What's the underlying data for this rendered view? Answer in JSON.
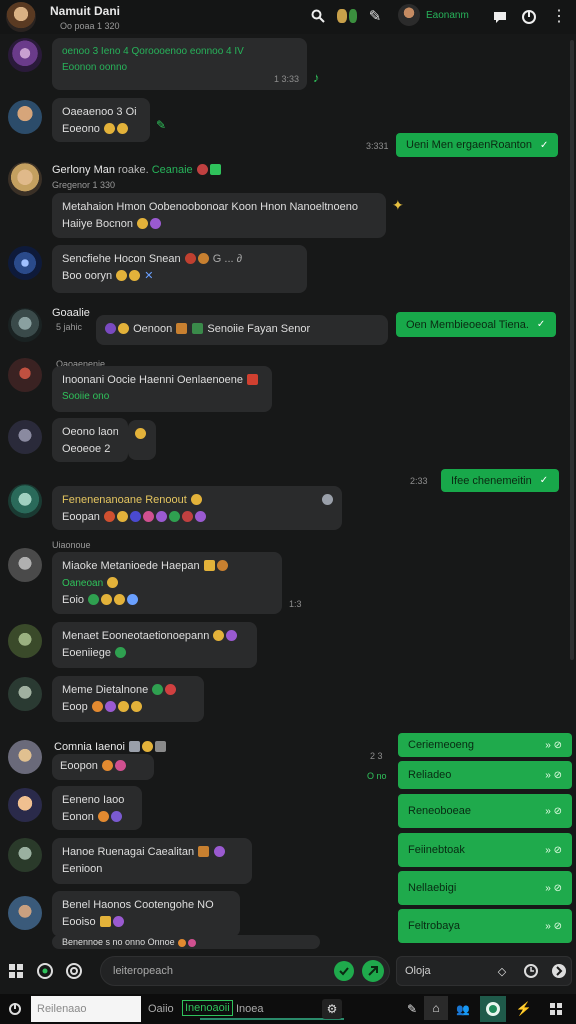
{
  "header": {
    "title": "Namuit Dani",
    "subtitle": "Oo poaa 1 320",
    "contact_name": "Eaonanm"
  },
  "messages_in": [
    {
      "line1": "oenoo 3 Ieno 4 Qoroooenoo eonnoo 4 IV",
      "line2": "Eoonon oonno",
      "time": "1 3:33"
    },
    {
      "line1": "Oaeaenoo 3 Oi 3",
      "line2": "Eoeono"
    },
    {
      "name": "Gerlony Man",
      "name_tag": "roake.",
      "name_tag2": "Ceanaie",
      "sub": "Gregenor 1 330",
      "line1": "Metahaion Hmon Oobenoobonoar Koon Hnon Nanoeltnoeno",
      "line2": "Haiiye Bocnon"
    },
    {
      "line1": "Sencfiehe Hocon Snean",
      "line2": "Boo ooryn"
    },
    {
      "name": "Goaalie",
      "sub": "5 jahic",
      "line1": "Oenoon",
      "line2": "Senoiie Fayan Senor"
    },
    {
      "sub": "Oaoaenenie",
      "line1": "Inoonani Oocie Haenni Oenlaenoene",
      "line2": "Sooiie ono"
    },
    {
      "line1": "Oeono laono",
      "line2": "Oeoeoe 2"
    },
    {
      "line1": "Fenenenanoane Renoout",
      "line2": "Eoopan"
    },
    {
      "sub": "Uiaonoue",
      "line1": "Miaoke Metanioede Haepan",
      "line2": "Oaneoan",
      "line3": "Eoio",
      "time": "1:3"
    },
    {
      "line1": "Menaet Eooneotaetionoepann",
      "line2": "Eoeniiege"
    },
    {
      "line1": "Meme Dietalnone",
      "line2": "Eoop"
    },
    {
      "name": "Comnia Iaenoi",
      "line1": "Eoopon",
      "time": "2 3"
    },
    {
      "line1": "Eeneno Iaoo",
      "line2": "Eonon"
    },
    {
      "line1": "Hanoe Ruenagai Caealitan",
      "line2": "Eenioon"
    },
    {
      "line1": "Benel Haonos Cootengohe NO",
      "line2": "Eooiso"
    },
    {
      "line1": "Benennoe s no onno Onnoe"
    }
  ],
  "messages_out": [
    {
      "text": "Ueni Men ergaenRoanton",
      "time": "3:331"
    },
    {
      "text": "Oen Membieoeoal Tiena."
    },
    {
      "text": "Ifee chenemeitin",
      "time": "2:33"
    }
  ],
  "quick_replies": [
    {
      "label": "Ceriemeoeng"
    },
    {
      "label": "Reliadeo"
    },
    {
      "label": "Reneoboeae"
    },
    {
      "label": "Feiinebtoak"
    },
    {
      "label": "Nellaebigi"
    },
    {
      "label": "Feltrobaya"
    }
  ],
  "side_label": "O no",
  "composer": {
    "placeholder": "leiteropeach"
  },
  "composer2": {
    "value": "Oloja"
  },
  "taskbar": {
    "field1": "Reilenaao",
    "field2": "Oaiio",
    "field3": "Inenoaoii",
    "field4": "Inoea"
  },
  "colors": {
    "accent": "#1faa4c",
    "bg": "#171818",
    "bubble": "#2a2b2c"
  }
}
